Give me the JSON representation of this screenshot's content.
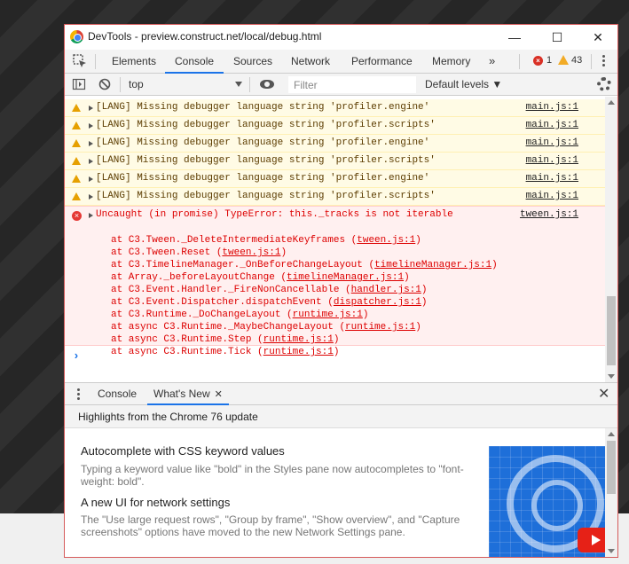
{
  "window": {
    "title": "DevTools - preview.construct.net/local/debug.html",
    "minimize": "—",
    "maximize": "☐",
    "close": "✕"
  },
  "tabs": [
    {
      "label": "Elements"
    },
    {
      "label": "Console"
    },
    {
      "label": "Sources"
    },
    {
      "label": "Network"
    },
    {
      "label": "Performance"
    },
    {
      "label": "Memory"
    }
  ],
  "tabs_more": "»",
  "badges": {
    "errors": "1",
    "warnings": "43",
    "error_icon": "×"
  },
  "toolbar": {
    "context": "top",
    "filter_placeholder": "Filter",
    "levels": "Default levels ▼"
  },
  "warnings": [
    {
      "text": "[LANG] Missing debugger language string 'profiler.engine'",
      "source": "main.js:1"
    },
    {
      "text": "[LANG] Missing debugger language string 'profiler.scripts'",
      "source": "main.js:1"
    },
    {
      "text": "[LANG] Missing debugger language string 'profiler.engine'",
      "source": "main.js:1"
    },
    {
      "text": "[LANG] Missing debugger language string 'profiler.scripts'",
      "source": "main.js:1"
    },
    {
      "text": "[LANG] Missing debugger language string 'profiler.engine'",
      "source": "main.js:1"
    },
    {
      "text": "[LANG] Missing debugger language string 'profiler.scripts'",
      "source": "main.js:1"
    }
  ],
  "error": {
    "icon": "×",
    "text": "Uncaught (in promise) TypeError: this._tracks is not iterable",
    "source": "tween.js:1",
    "stack": [
      {
        "text": "at C3.Tween._DeleteIntermediateKeyframes (",
        "link": "tween.js:1",
        "end": ")"
      },
      {
        "text": "at C3.Tween.Reset (",
        "link": "tween.js:1",
        "end": ")"
      },
      {
        "text": "at C3.TimelineManager._OnBeforeChangeLayout (",
        "link": "timelineManager.js:1",
        "end": ")"
      },
      {
        "text": "at Array._beforeLayoutChange (",
        "link": "timelineManager.js:1",
        "end": ")"
      },
      {
        "text": "at C3.Event.Handler._FireNonCancellable (",
        "link": "handler.js:1",
        "end": ")"
      },
      {
        "text": "at C3.Event.Dispatcher.dispatchEvent (",
        "link": "dispatcher.js:1",
        "end": ")"
      },
      {
        "text": "at C3.Runtime._DoChangeLayout (",
        "link": "runtime.js:1",
        "end": ")"
      },
      {
        "text": "at async C3.Runtime._MaybeChangeLayout (",
        "link": "runtime.js:1",
        "end": ")"
      },
      {
        "text": "at async C3.Runtime.Step (",
        "link": "runtime.js:1",
        "end": ")"
      },
      {
        "text": "at async C3.Runtime.Tick (",
        "link": "runtime.js:1",
        "end": ")"
      }
    ]
  },
  "prompt": "›",
  "drawer": {
    "tabs": [
      {
        "label": "Console"
      },
      {
        "label": "What's New"
      }
    ],
    "tab_close": "✕",
    "close": "✕",
    "highlights": "Highlights from the Chrome 76 update"
  },
  "whats_new": [
    {
      "title": "Autocomplete with CSS keyword values",
      "desc": "Typing a keyword value like \"bold\" in the Styles pane now autocompletes to \"font-weight: bold\"."
    },
    {
      "title": "A new UI for network settings",
      "desc": "The \"Use large request rows\", \"Group by frame\", \"Show overview\", and \"Capture screenshots\" options have moved to the new Network Settings pane."
    }
  ]
}
